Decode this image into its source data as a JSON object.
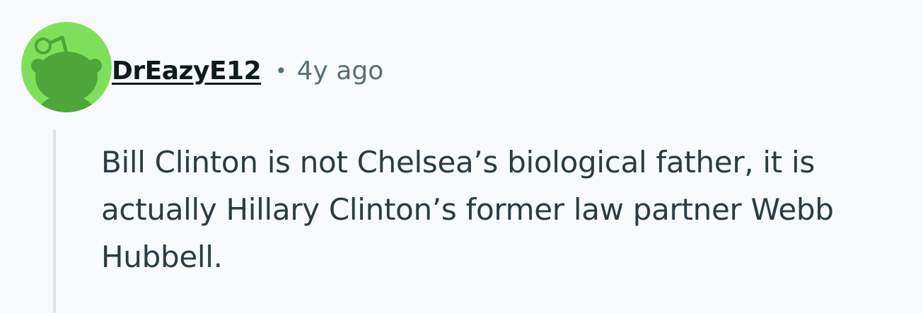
{
  "comment": {
    "avatar_icon": "reddit-snoo-avatar-icon",
    "avatar_bg_color": "#7ee05a",
    "avatar_fg_color": "#4ea63a",
    "username": "DrEazyE12",
    "separator": "•",
    "timestamp": "4y ago",
    "body": "Bill Clinton is not Chelsea’s biological father, it is actually Hillary Clinton’s former law partner Webb Hubbell."
  }
}
